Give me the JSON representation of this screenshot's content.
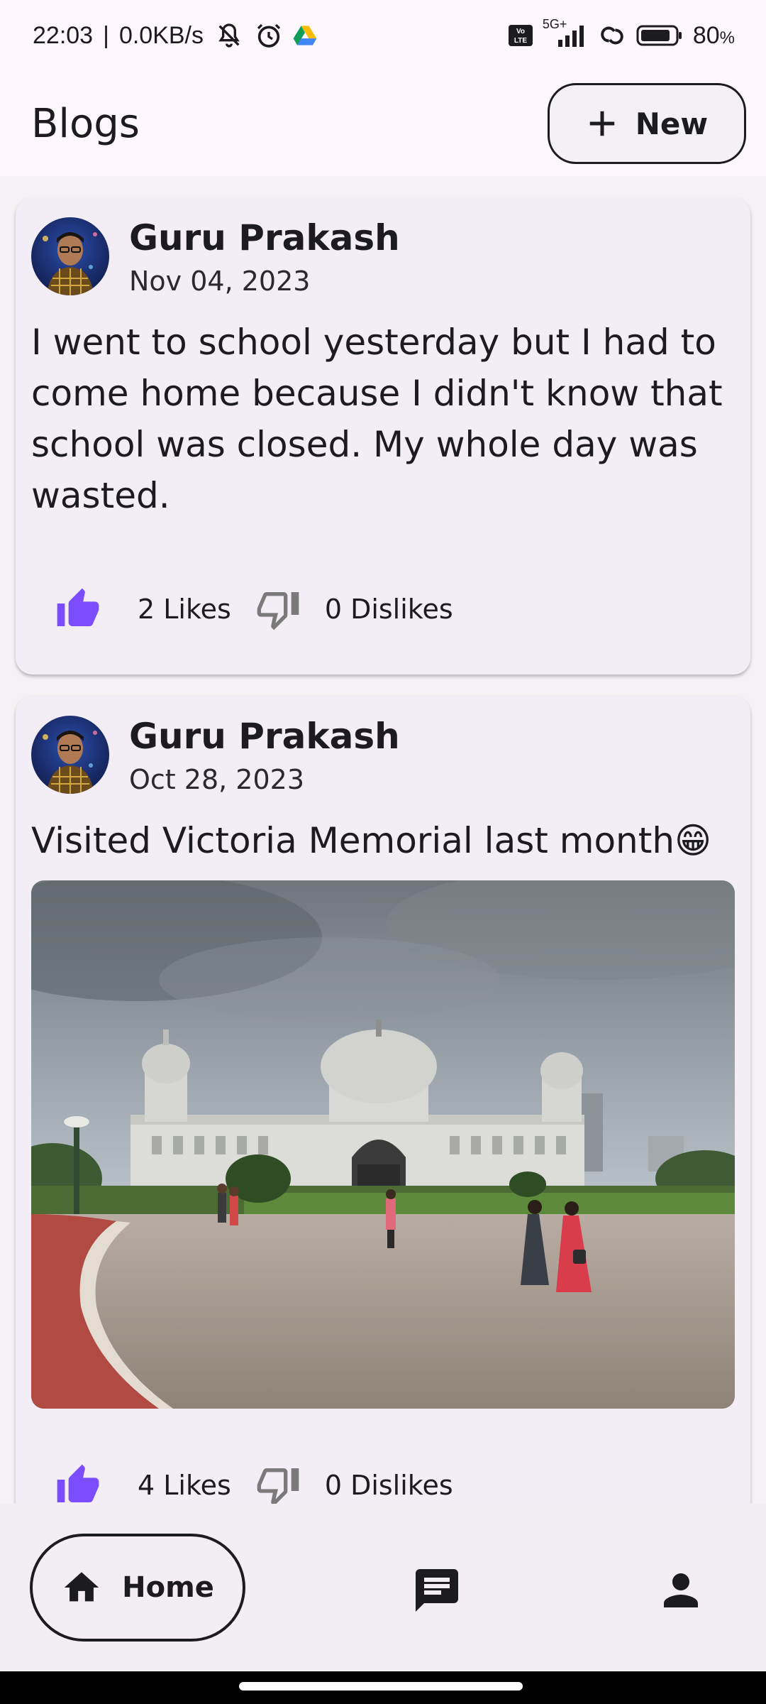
{
  "status_bar": {
    "time": "22:03",
    "net_speed": "0.0KB/s",
    "network": "5G+",
    "volte": "Vo LTE",
    "battery": "80",
    "battery_unit": "%"
  },
  "header": {
    "title": "Blogs",
    "new_button_label": "New"
  },
  "posts": [
    {
      "author": "Guru Prakash",
      "date": "Nov 04, 2023",
      "text": "I went to school yesterday but I had to come home because I didn't know that school was closed. My whole day was wasted.",
      "likes": "2 Likes",
      "dislikes": "0 Dislikes",
      "has_image": false
    },
    {
      "author": "Guru Prakash",
      "date": "Oct 28, 2023",
      "text": "Visited Victoria Memorial last month😁",
      "likes": "4 Likes",
      "dislikes": "0 Dislikes",
      "has_image": true
    }
  ],
  "nav": {
    "home_label": "Home",
    "items": [
      "home-icon",
      "chat-icon",
      "profile-icon"
    ]
  },
  "colors": {
    "accent": "#7c4dff",
    "surface": "#f3edf6",
    "background": "#fef7fb"
  }
}
